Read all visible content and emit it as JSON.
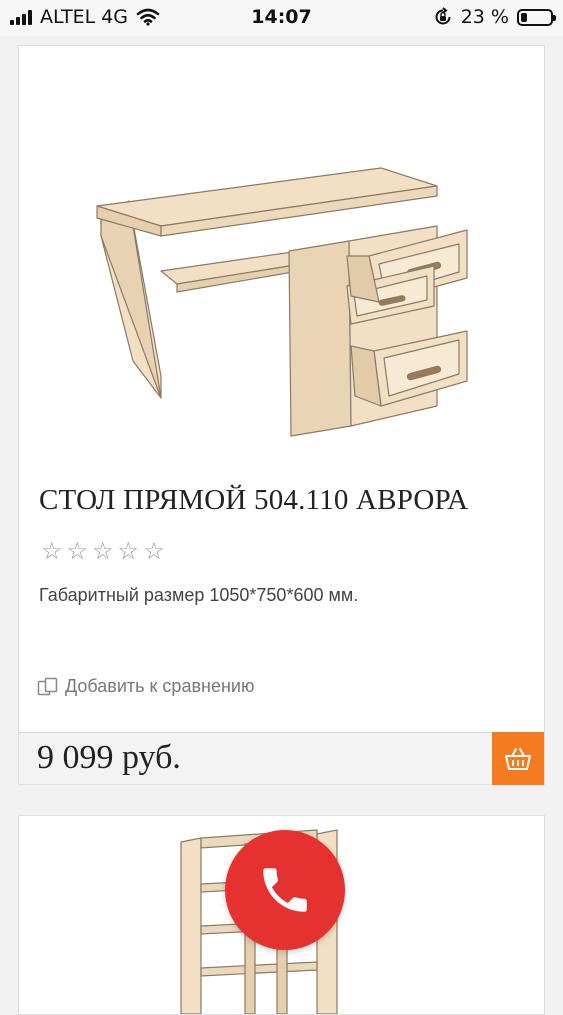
{
  "status_bar": {
    "carrier": "ALTEL 4G",
    "time": "14:07",
    "battery_percent": "23 %",
    "battery_level": 0.23
  },
  "product": {
    "title": "СТОЛ ПРЯМОЙ 504.110 АВРОРА",
    "rating": {
      "max": 5,
      "value": 0
    },
    "description": "Габаритный размер 1050*750*600 мм.",
    "compare_label": "Добавить к сравнению",
    "price": "9 099 руб."
  },
  "colors": {
    "accent_orange": "#f47b20",
    "call_red": "#e5312f",
    "wood": "#f2dfc4"
  },
  "icons": {
    "cart": "basket-icon",
    "call": "phone-icon",
    "compare": "compare-icon"
  }
}
